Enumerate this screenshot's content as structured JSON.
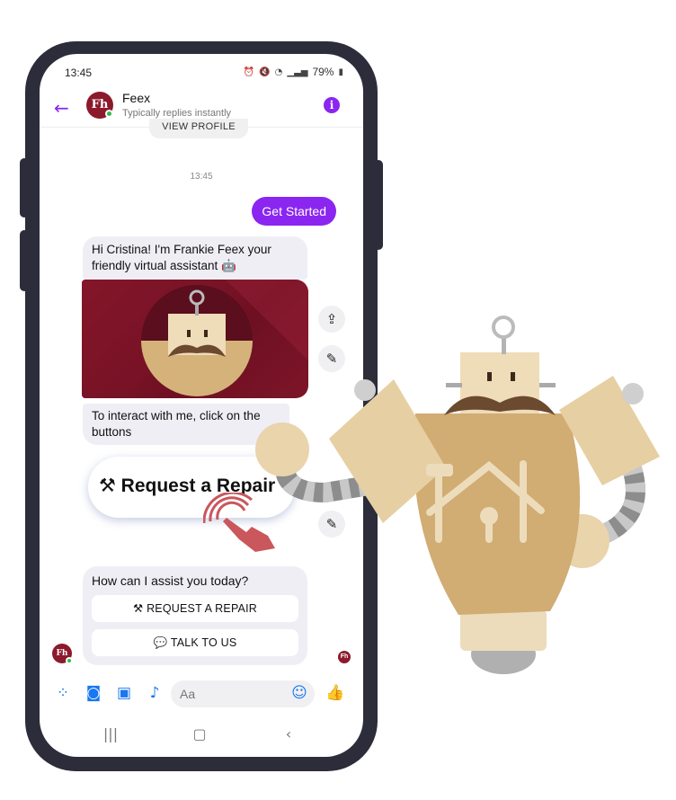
{
  "status_bar": {
    "time": "13:45",
    "battery": "79%"
  },
  "header": {
    "page_name": "Feex",
    "subtitle": "Typically replies instantly",
    "avatar_text": "Fh"
  },
  "thread": {
    "view_profile": "VIEW PROFILE",
    "timestamp": "13:45",
    "user_message": "Get Started",
    "greeting": "Hi Cristina!  I'm Frankie Feex your friendly virtual assistant 🤖",
    "instruction": "To interact with me, click on the buttons",
    "request_pill": "⚒ Request a Repair",
    "question": "How can I assist you today?",
    "quick_replies": [
      "⚒ REQUEST A REPAIR",
      "💬 TALK TO US"
    ]
  },
  "composer": {
    "placeholder": "Aa"
  },
  "colors": {
    "accent": "#8a26f0",
    "messenger_blue": "#1877f2",
    "brand": "#8c1a2c",
    "robot_tan": "#d1ac73"
  },
  "icons": [
    "back-arrow-icon",
    "info-icon",
    "share-icon",
    "edit-icon",
    "apps-icon",
    "camera-icon",
    "gallery-icon",
    "mic-icon",
    "emoji-icon",
    "thumbs-up-icon"
  ]
}
